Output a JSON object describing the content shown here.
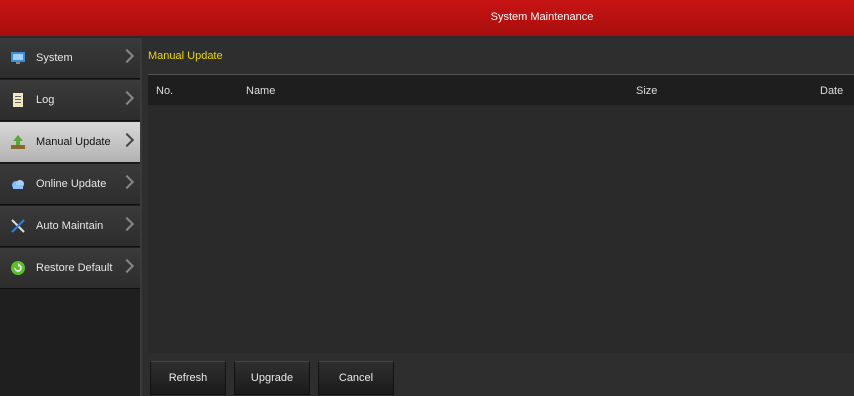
{
  "window": {
    "title": "System Maintenance"
  },
  "sidebar": {
    "items": [
      {
        "label": "System",
        "icon": "monitor-icon"
      },
      {
        "label": "Log",
        "icon": "log-icon"
      },
      {
        "label": "Manual Update",
        "icon": "upload-icon",
        "active": true
      },
      {
        "label": "Online Update",
        "icon": "cloud-icon"
      },
      {
        "label": "Auto Maintain",
        "icon": "tools-icon"
      },
      {
        "label": "Restore Default",
        "icon": "restore-icon"
      }
    ]
  },
  "main": {
    "section_title": "Manual Update",
    "columns": [
      "No.",
      "Name",
      "Size",
      "Date"
    ],
    "rows": []
  },
  "buttons": {
    "refresh": "Refresh",
    "upgrade": "Upgrade",
    "cancel": "Cancel"
  },
  "colors": {
    "titlebar": "#c81414",
    "section_title": "#e8d400"
  }
}
